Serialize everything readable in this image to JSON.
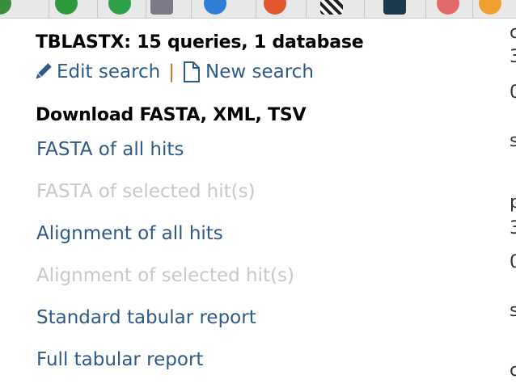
{
  "results_panel": {
    "title": "TBLASTX: 15 queries, 1 database",
    "edit_search_label": "Edit search",
    "separator": "|",
    "new_search_label": "New search",
    "download_heading": "Download FASTA, XML, TSV",
    "links": [
      {
        "label": "FASTA of all hits",
        "enabled": true
      },
      {
        "label": "FASTA of selected hit(s)",
        "enabled": false
      },
      {
        "label": "Alignment of all hits",
        "enabled": true
      },
      {
        "label": "Alignment of selected hit(s)",
        "enabled": false
      },
      {
        "label": "Standard tabular report",
        "enabled": true
      },
      {
        "label": "Full tabular report",
        "enabled": true
      }
    ]
  },
  "right_column_clipped": [
    "c",
    "3",
    "0",
    "s",
    "p",
    "3",
    "0",
    "s",
    "c"
  ],
  "colors": {
    "link": "#2f5a86",
    "disabled": "#c9c9c9",
    "separator": "#c0741f",
    "heading": "#000000"
  },
  "icons": {
    "edit": "pencil-icon",
    "new": "document-icon"
  }
}
